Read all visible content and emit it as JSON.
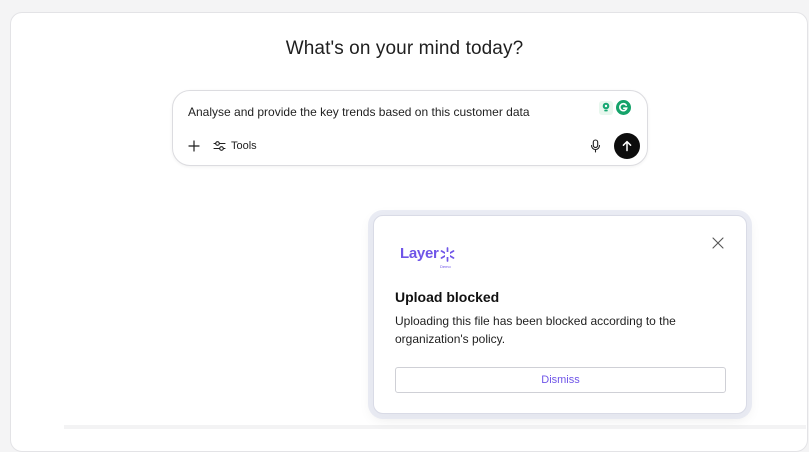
{
  "main": {
    "headline": "What's on your mind today?"
  },
  "composer": {
    "input_value": "Analyse and provide the key trends based on this customer data",
    "tools_label": "Tools",
    "icons": {
      "plus": "plus-icon",
      "tools": "sliders-icon",
      "mic": "microphone-icon",
      "send": "arrow-up-icon",
      "extension_1": "lightbulb-extension-icon",
      "extension_2": "grammarly-extension-icon"
    }
  },
  "popup": {
    "logo_text": "Layer",
    "logo_subtext": "Demo",
    "title": "Upload blocked",
    "message": "Uploading this file has been blocked according to the organization's policy.",
    "dismiss_label": "Dismiss",
    "close_icon": "close-icon"
  },
  "colors": {
    "accent": "#6f55e8",
    "send_button": "#0d0d0d",
    "extension_green": "#15a36a"
  }
}
